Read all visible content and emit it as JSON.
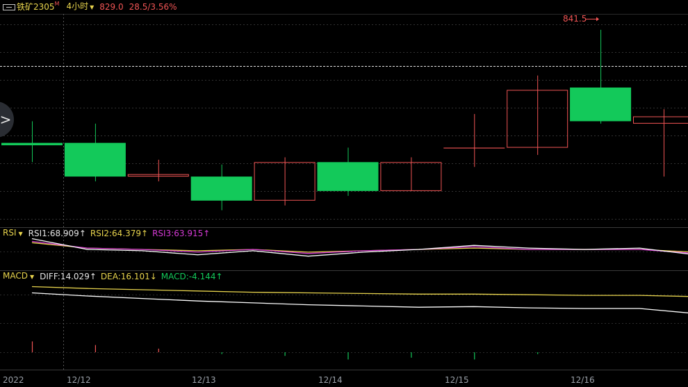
{
  "header": {
    "symbol": "铁矿2305",
    "symbol_badge": "M",
    "period": "4小时",
    "price": "829.0",
    "change": "28.5/3.56%"
  },
  "rsi": {
    "name": "RSI",
    "rsi1": "RSI1:68.909↑",
    "rsi2": "RSI2:64.379↑",
    "rsi3": "RSI3:63.915↑"
  },
  "macd": {
    "name": "MACD",
    "diff": "DIFF:14.029↑",
    "dea": "DEA:16.101↓",
    "macd": "MACD:-4.144↑"
  },
  "high_label": "841.5",
  "time_axis": [
    "2022",
    "12/12",
    "12/13",
    "12/14",
    "12/15",
    "12/16"
  ],
  "colors": {
    "up": "#f25555",
    "down": "#13c95a",
    "text_dim": "#9aa0a8",
    "yellow": "#e8d44d",
    "magenta": "#d63ad6"
  },
  "chart_data": {
    "type": "candlestick",
    "candles": [
      {
        "o": 818.0,
        "h": 822.5,
        "l": 814.0,
        "c": 817.5
      },
      {
        "o": 818.0,
        "h": 822.0,
        "l": 810.0,
        "c": 811.0
      },
      {
        "o": 811.0,
        "h": 814.5,
        "l": 810.0,
        "c": 811.5
      },
      {
        "o": 811.0,
        "h": 813.5,
        "l": 804.0,
        "c": 806.0
      },
      {
        "o": 806.0,
        "h": 815.0,
        "l": 805.0,
        "c": 814.0
      },
      {
        "o": 814.0,
        "h": 817.0,
        "l": 807.0,
        "c": 808.0
      },
      {
        "o": 808.0,
        "h": 815.0,
        "l": 808.0,
        "c": 814.0
      },
      {
        "o": 817.0,
        "h": 824.0,
        "l": 813.0,
        "c": 817.0
      },
      {
        "o": 817.0,
        "h": 832.0,
        "l": 815.5,
        "c": 829.0
      },
      {
        "o": 829.5,
        "h": 841.5,
        "l": 822.0,
        "c": 822.5
      },
      {
        "o": 822.0,
        "h": 825.0,
        "l": 811.0,
        "c": 823.5
      }
    ],
    "rsi": {
      "rsi1": [
        68,
        60,
        59,
        56,
        59,
        55,
        58,
        60,
        63,
        61,
        60,
        61,
        56
      ],
      "rsi2": [
        66,
        61,
        60,
        58,
        60,
        57,
        59,
        60,
        62,
        60,
        60,
        60,
        57
      ],
      "rsi3": [
        65,
        61,
        60,
        59,
        60,
        58,
        59,
        60,
        61,
        60,
        60,
        60,
        58
      ]
    },
    "macd": {
      "diff": [
        16.5,
        16.0,
        15.6,
        15.2,
        14.9,
        14.6,
        14.4,
        14.2,
        14.3,
        14.1,
        14.0,
        14.0,
        13.2
      ],
      "dea": [
        17.5,
        17.2,
        17.0,
        16.8,
        16.6,
        16.5,
        16.4,
        16.3,
        16.3,
        16.2,
        16.1,
        16.1,
        15.9
      ],
      "bars": [
        6,
        4,
        2,
        -1,
        -2,
        -4,
        -3,
        -4,
        -1,
        0,
        0,
        0,
        -1
      ]
    }
  }
}
